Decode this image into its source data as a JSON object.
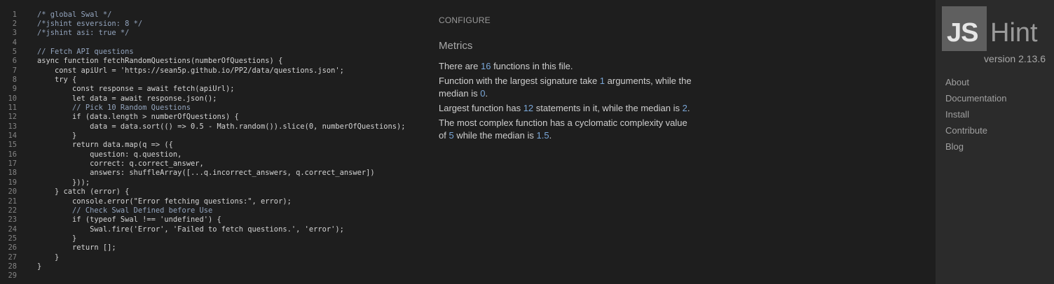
{
  "editor": {
    "lines": [
      {
        "n": "1",
        "t": "/* global Swal */"
      },
      {
        "n": "2",
        "t": "/*jshint esversion: 8 */"
      },
      {
        "n": "3",
        "t": "/*jshint asi: true */"
      },
      {
        "n": "4",
        "t": ""
      },
      {
        "n": "5",
        "t": "// Fetch API questions"
      },
      {
        "n": "6",
        "t": "async function fetchRandomQuestions(numberOfQuestions) {"
      },
      {
        "n": "7",
        "t": "    const apiUrl = 'https://sean5p.github.io/PP2/data/questions.json';"
      },
      {
        "n": "8",
        "t": "    try {"
      },
      {
        "n": "9",
        "t": "        const response = await fetch(apiUrl);"
      },
      {
        "n": "10",
        "t": "        let data = await response.json();"
      },
      {
        "n": "11",
        "t": "        // Pick 10 Random Questions"
      },
      {
        "n": "12",
        "t": "        if (data.length > numberOfQuestions) {"
      },
      {
        "n": "13",
        "t": "            data = data.sort(() => 0.5 - Math.random()).slice(0, numberOfQuestions);"
      },
      {
        "n": "14",
        "t": "        }"
      },
      {
        "n": "15",
        "t": "        return data.map(q => ({"
      },
      {
        "n": "16",
        "t": "            question: q.question,"
      },
      {
        "n": "17",
        "t": "            correct: q.correct_answer,"
      },
      {
        "n": "18",
        "t": "            answers: shuffleArray([...q.incorrect_answers, q.correct_answer])"
      },
      {
        "n": "19",
        "t": "        }));"
      },
      {
        "n": "20",
        "t": "    } catch (error) {"
      },
      {
        "n": "21",
        "t": "        console.error(\"Error fetching questions:\", error);"
      },
      {
        "n": "22",
        "t": "        // Check Swal Defined before Use"
      },
      {
        "n": "23",
        "t": "        if (typeof Swal !== 'undefined') {"
      },
      {
        "n": "24",
        "t": "            Swal.fire('Error', 'Failed to fetch questions.', 'error');"
      },
      {
        "n": "25",
        "t": "        }"
      },
      {
        "n": "26",
        "t": "        return [];"
      },
      {
        "n": "27",
        "t": "    }"
      },
      {
        "n": "28",
        "t": "}"
      },
      {
        "n": "29",
        "t": ""
      }
    ]
  },
  "report": {
    "configure_label": "CONFIGURE",
    "metrics_title": "Metrics",
    "m1_a": "There are ",
    "m1_n": "16",
    "m1_b": " functions in this file.",
    "m2_a": "Function with the largest signature take ",
    "m2_n1": "1",
    "m2_b": " arguments, while the median is ",
    "m2_n2": "0",
    "m2_c": ".",
    "m3_a": "Largest function has ",
    "m3_n1": "12",
    "m3_b": " statements in it, while the median is ",
    "m3_n2": "2",
    "m3_c": ".",
    "m4_a": "The most complex function has a cyclomatic complexity value of ",
    "m4_n1": "5",
    "m4_b": " while the median is ",
    "m4_n2": "1.5",
    "m4_c": "."
  },
  "sidebar": {
    "logo_js": "JS",
    "logo_hint": "Hint",
    "version": "version 2.13.6",
    "links": [
      "About",
      "Documentation",
      "Install",
      "Contribute",
      "Blog"
    ]
  }
}
